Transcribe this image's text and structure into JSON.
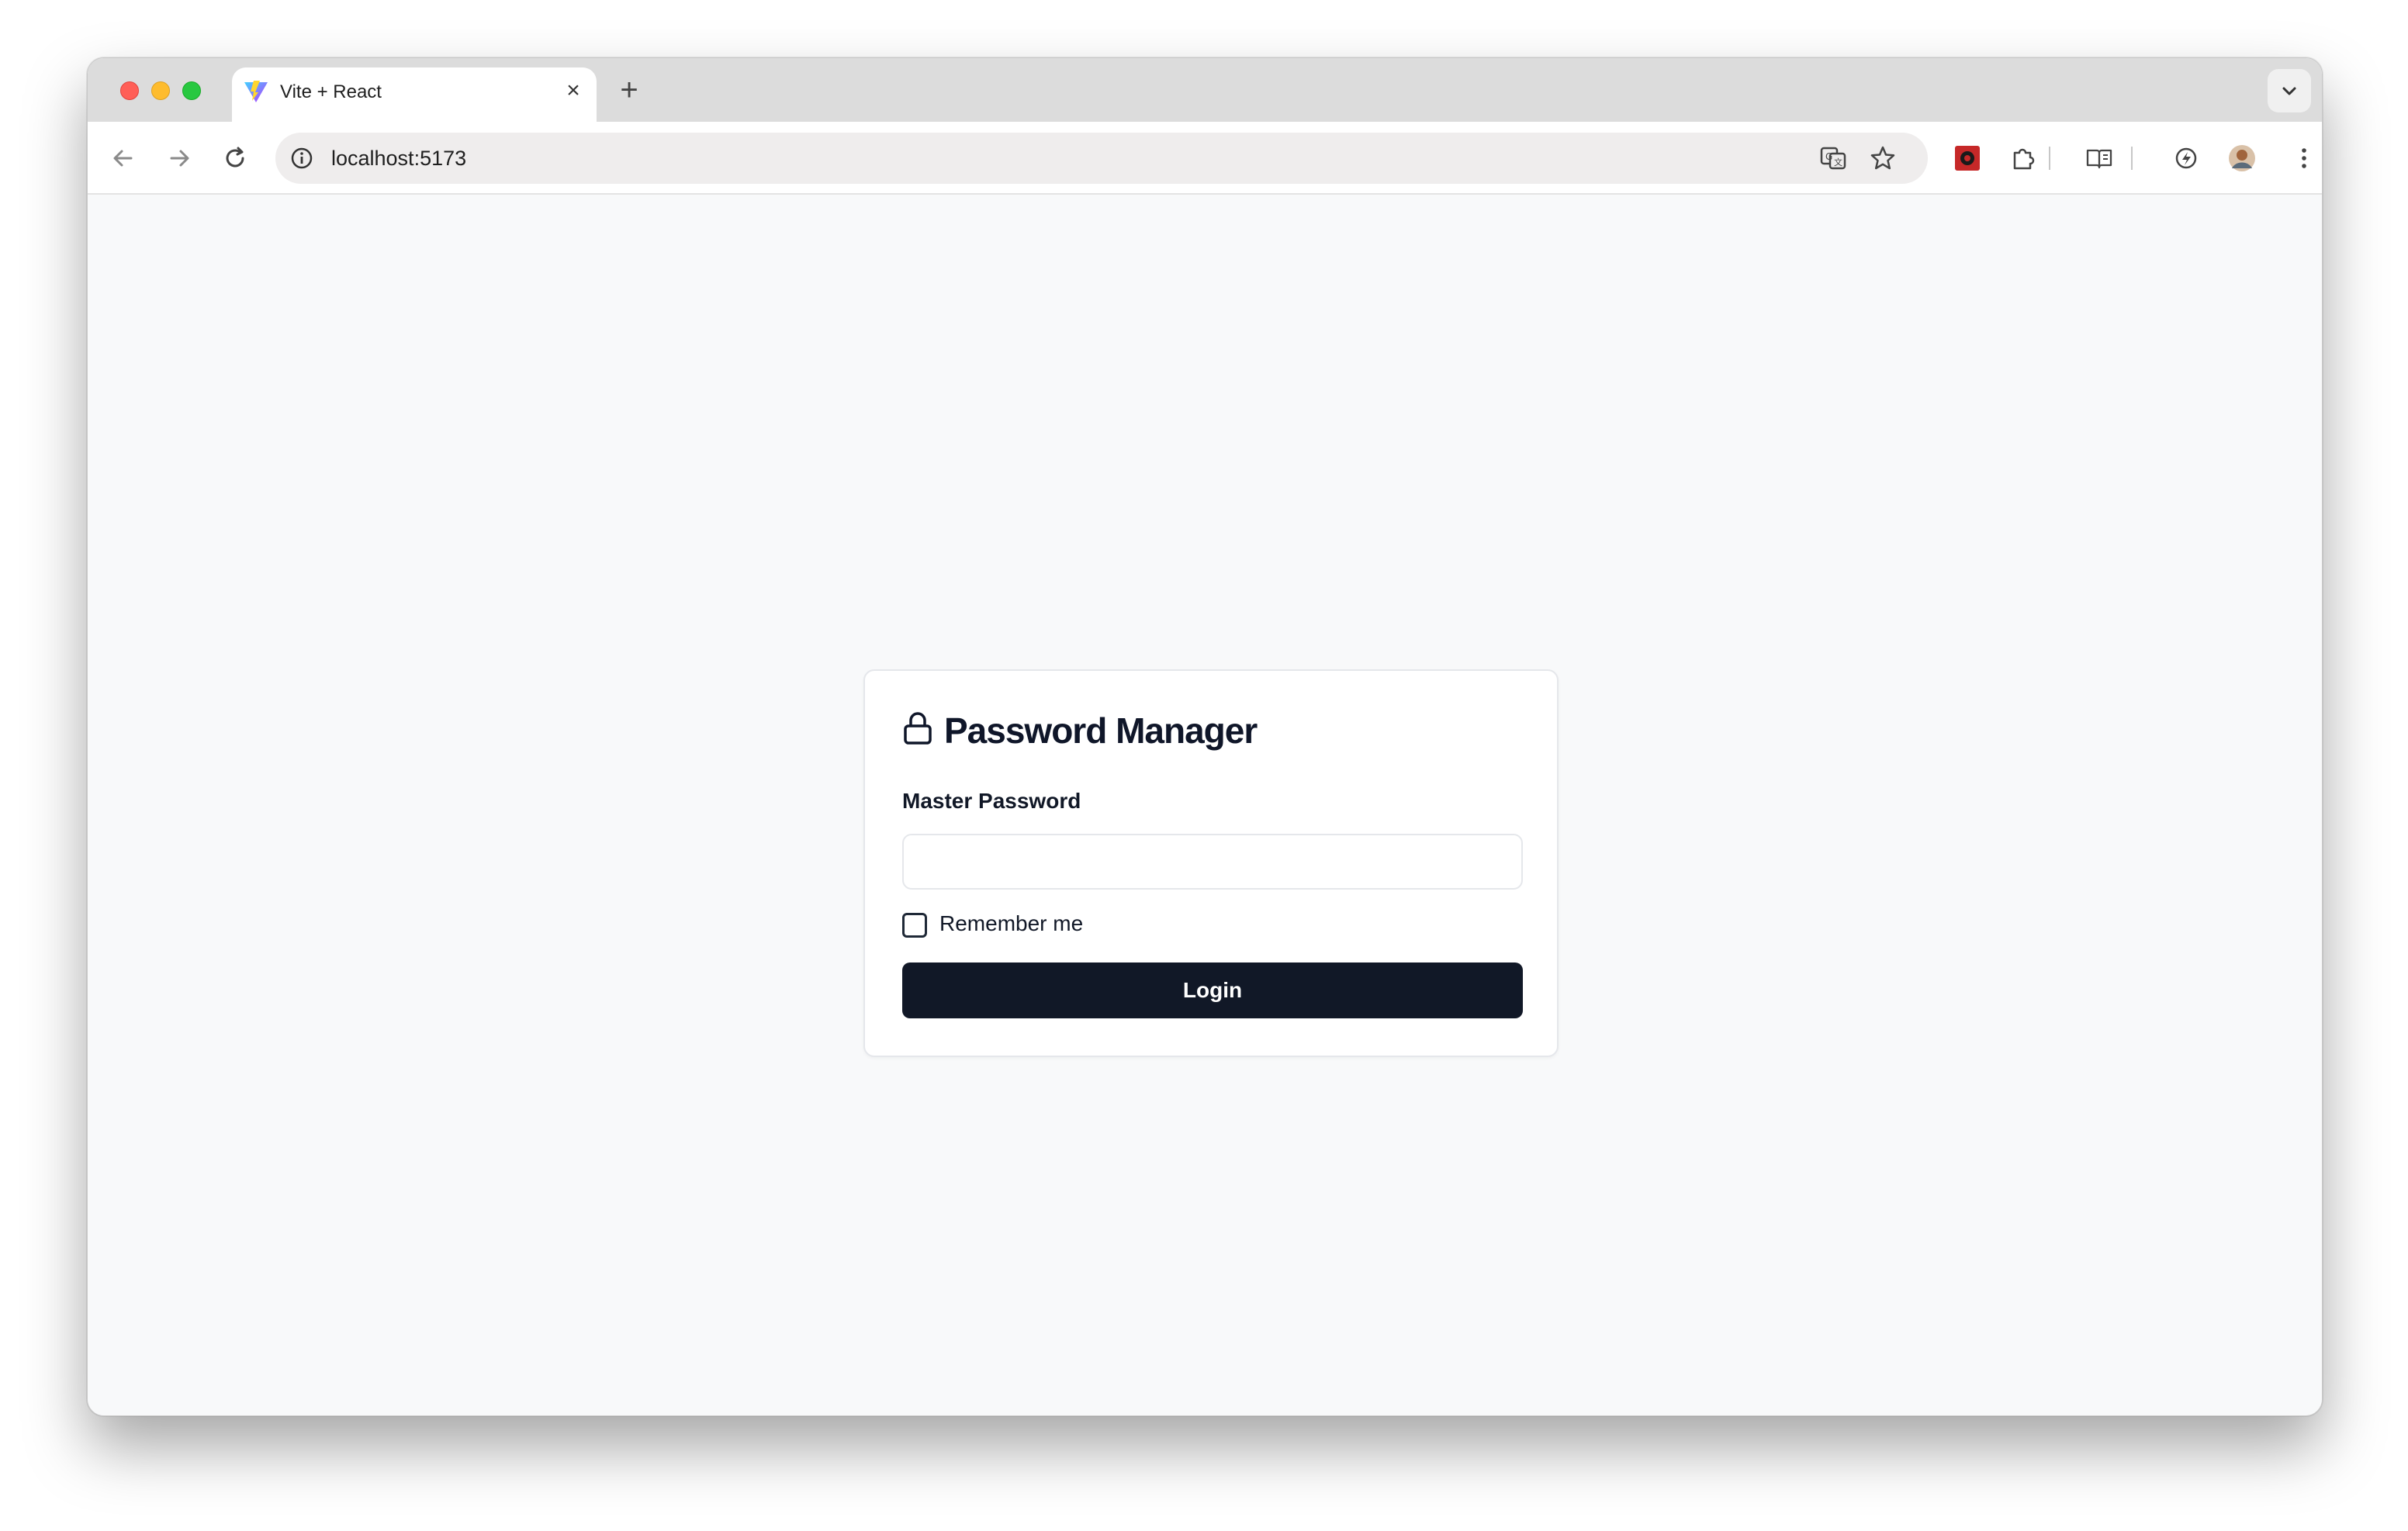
{
  "browser": {
    "tab": {
      "title": "Vite + React",
      "favicon": "vite-logo"
    },
    "address_bar": {
      "url": "localhost:5173"
    },
    "icons": [
      "back-arrow-icon",
      "forward-arrow-icon",
      "reload-icon",
      "info-icon",
      "translate-icon",
      "star-icon",
      "extension-red-icon",
      "puzzle-icon",
      "reading-mode-icon",
      "performance-icon",
      "profile-avatar",
      "kebab-menu-icon"
    ]
  },
  "login_card": {
    "title": "Password Manager",
    "title_icon": "lock-icon",
    "password_label": "Master Password",
    "password_value": "",
    "remember_label": "Remember me",
    "remember_checked": false,
    "login_button": "Login"
  },
  "colors": {
    "page_bg": "#f8f9fa",
    "button_bg": "#111827",
    "button_text": "#ffffff",
    "title_text": "#0f1629"
  }
}
